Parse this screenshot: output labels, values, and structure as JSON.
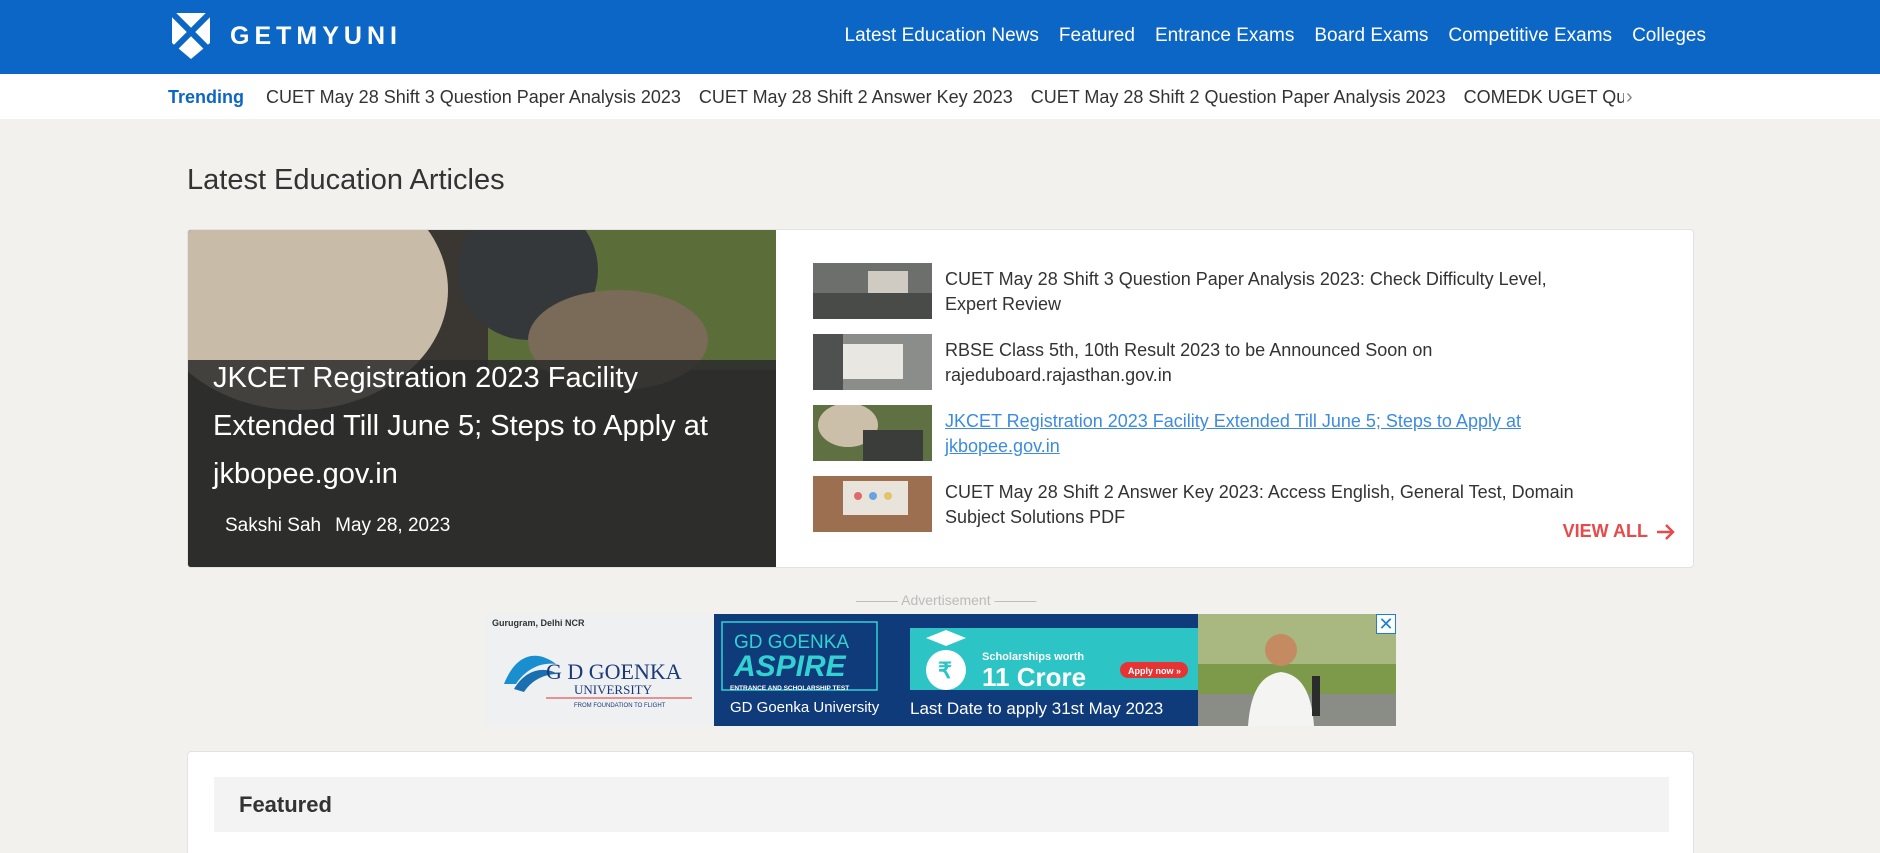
{
  "header": {
    "logo_text": "GETMYUNI",
    "nav": [
      "Latest Education News",
      "Featured",
      "Entrance Exams",
      "Board Exams",
      "Competitive Exams",
      "Colleges"
    ]
  },
  "trending": {
    "label": "Trending",
    "items": [
      "CUET May 28 Shift 3 Question Paper Analysis 2023",
      "CUET May 28 Shift 2 Answer Key 2023",
      "CUET May 28 Shift 2 Question Paper Analysis 2023",
      "COMEDK UGET Ques"
    ],
    "next_icon": "chevron-right-icon"
  },
  "main": {
    "section_title": "Latest Education Articles",
    "hero": {
      "title": "JKCET Registration 2023 Facility Extended Till June 5; Steps to Apply at jkbopee.gov.in",
      "author": "Sakshi Sah",
      "date": "May 28, 2023"
    },
    "articles": [
      "CUET May 28 Shift 3 Question Paper Analysis 2023: Check Difficulty Level, Expert Review",
      "RBSE Class 5th, 10th Result 2023 to be Announced Soon on rajeduboard.rajasthan.gov.in",
      "JKCET Registration 2023 Facility Extended Till June 5; Steps to Apply at jkbopee.gov.in",
      "CUET May 28 Shift 2 Answer Key 2023: Access English, General Test, Domain Subject Solutions PDF"
    ],
    "view_all": "VIEW ALL"
  },
  "ad": {
    "label": "——— Advertisement ———",
    "location": "Gurugram, Delhi NCR",
    "university_line1": "G D GOENKA",
    "university_line2": "UNIVERSITY",
    "university_tagline": "FROM FOUNDATION TO FLIGHT",
    "aspire_line1": "GD GOENKA",
    "aspire_line2": "ASPIRE",
    "aspire_sub": "ENTRANCE AND SCHOLARSHIP TEST",
    "aspire_footer": "GD Goenka University",
    "scholar_line1": "Scholarships worth",
    "scholar_line2": "11 Crore",
    "apply": "Apply now »",
    "deadline": "Last Date to apply 31st May 2023",
    "close_icon": "close-icon"
  },
  "featured": {
    "title": "Featured"
  },
  "colors": {
    "brand_blue": "#0c66c6",
    "accent_red": "#e74a4a",
    "link_blue": "#3c8be0",
    "background": "#f2f1ee"
  }
}
